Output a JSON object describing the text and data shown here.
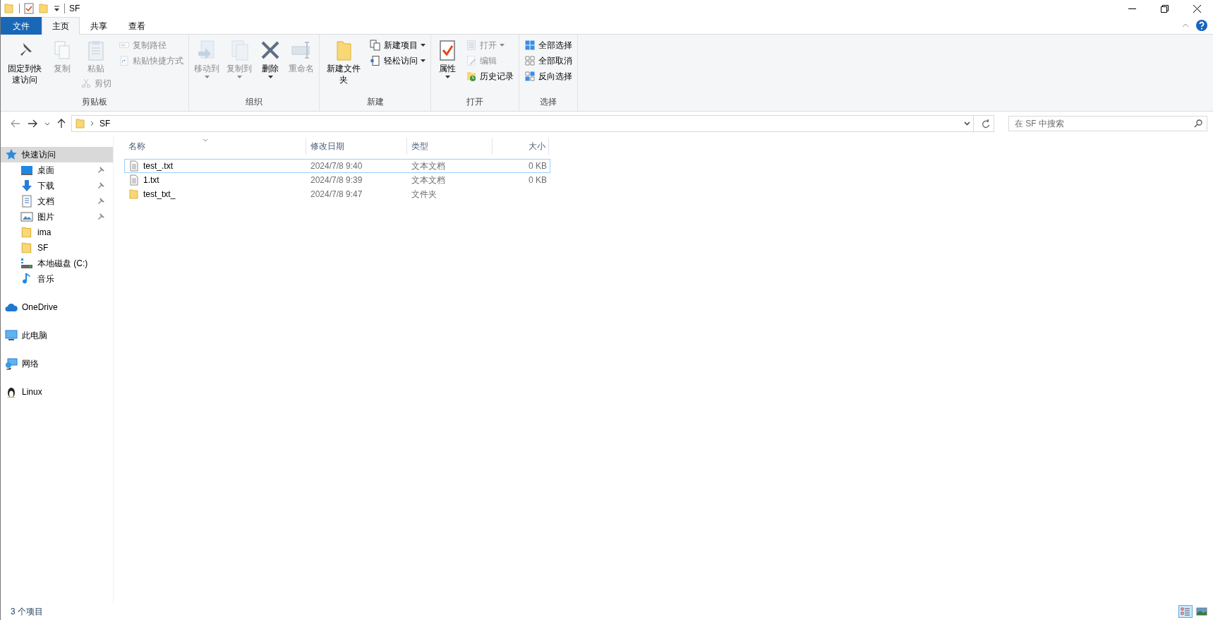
{
  "window": {
    "title": "SF"
  },
  "ribbon_tabs": [
    {
      "label": "文件",
      "kind": "file",
      "selected": false
    },
    {
      "label": "主页",
      "kind": "tab",
      "selected": true
    },
    {
      "label": "共享",
      "kind": "tab",
      "selected": false
    },
    {
      "label": "查看",
      "kind": "tab",
      "selected": false
    }
  ],
  "ribbon_groups": [
    {
      "label": "剪贴板",
      "columns": [
        [
          {
            "label": "固定到快速访问",
            "kind": "large",
            "disabled": false,
            "dropdown": false
          }
        ],
        [
          {
            "label": "复制",
            "kind": "large",
            "disabled": true,
            "dropdown": false
          }
        ],
        [
          {
            "label": "粘贴",
            "kind": "large",
            "disabled": true,
            "dropdown": false
          },
          {
            "label": "剪切",
            "kind": "small",
            "disabled": true,
            "dropdown": false
          }
        ],
        [
          {
            "label": "复制路径",
            "kind": "small",
            "disabled": true,
            "dropdown": false
          },
          {
            "label": "粘贴快捷方式",
            "kind": "small",
            "disabled": true,
            "dropdown": false
          }
        ]
      ]
    },
    {
      "label": "组织",
      "columns": [
        [
          {
            "label": "移动到",
            "kind": "large",
            "disabled": true,
            "dropdown": true
          }
        ],
        [
          {
            "label": "复制到",
            "kind": "large",
            "disabled": true,
            "dropdown": true
          }
        ],
        [
          {
            "label": "删除",
            "kind": "large",
            "disabled": false,
            "dropdown": true
          }
        ],
        [
          {
            "label": "重命名",
            "kind": "large",
            "disabled": true,
            "dropdown": false
          }
        ]
      ]
    },
    {
      "label": "新建",
      "columns": [
        [
          {
            "label": "新建文件夹",
            "kind": "large",
            "disabled": false,
            "dropdown": false
          }
        ],
        [
          {
            "label": "新建项目",
            "kind": "small",
            "disabled": false,
            "dropdown": true
          },
          {
            "label": "轻松访问",
            "kind": "small",
            "disabled": false,
            "dropdown": true
          }
        ]
      ]
    },
    {
      "label": "打开",
      "columns": [
        [
          {
            "label": "属性",
            "kind": "large",
            "disabled": false,
            "dropdown": true
          }
        ],
        [
          {
            "label": "打开",
            "kind": "small",
            "disabled": true,
            "dropdown": true
          },
          {
            "label": "编辑",
            "kind": "small",
            "disabled": true,
            "dropdown": false
          },
          {
            "label": "历史记录",
            "kind": "small",
            "disabled": false,
            "dropdown": false
          }
        ]
      ]
    },
    {
      "label": "选择",
      "columns": [
        [
          {
            "label": "全部选择",
            "kind": "small",
            "disabled": false,
            "dropdown": false
          },
          {
            "label": "全部取消",
            "kind": "small",
            "disabled": false,
            "dropdown": false
          },
          {
            "label": "反向选择",
            "kind": "small",
            "disabled": false,
            "dropdown": false
          }
        ]
      ]
    }
  ],
  "address": {
    "path": [
      "SF"
    ]
  },
  "search": {
    "placeholder": "在 SF 中搜索"
  },
  "sidebar": {
    "items": [
      {
        "label": "快速访问",
        "selected": true,
        "children": [
          {
            "label": "桌面",
            "selected": false,
            "pinned": true
          },
          {
            "label": "下载",
            "selected": false,
            "pinned": true
          },
          {
            "label": "文档",
            "selected": false,
            "pinned": true
          },
          {
            "label": "图片",
            "selected": false,
            "pinned": true
          },
          {
            "label": "ima",
            "selected": false,
            "pinned": false
          },
          {
            "label": "SF",
            "selected": false,
            "pinned": false
          },
          {
            "label": "本地磁盘 (C:)",
            "selected": false,
            "pinned": false
          },
          {
            "label": "音乐",
            "selected": false,
            "pinned": false
          }
        ]
      },
      {
        "label": "OneDrive",
        "selected": false
      },
      {
        "label": "此电脑",
        "selected": false
      },
      {
        "label": "网络",
        "selected": false
      },
      {
        "label": "Linux",
        "selected": false
      }
    ]
  },
  "table": {
    "columns": [
      "名称",
      "修改日期",
      "类型",
      "大小"
    ],
    "rows": [
      {
        "name": "test_.txt",
        "date": "2024/7/8 9:40",
        "type": "文本文档",
        "size": "0 KB",
        "kind": "file",
        "focused": true,
        "selected": false
      },
      {
        "name": "1.txt",
        "date": "2024/7/8 9:39",
        "type": "文本文档",
        "size": "0 KB",
        "kind": "file",
        "focused": false,
        "selected": false
      },
      {
        "name": "test_txt_",
        "date": "2024/7/8 9:47",
        "type": "文件夹",
        "kind": "folder",
        "focused": false,
        "selected": false
      }
    ]
  },
  "status_bar": {
    "text": "3 个项目"
  },
  "view_buttons": [
    {
      "selected": true
    },
    {
      "selected": false
    }
  ]
}
